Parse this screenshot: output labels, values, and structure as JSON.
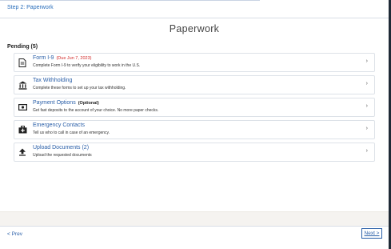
{
  "header": {
    "step_label": "Step 2: Paperwork"
  },
  "page": {
    "title": "Paperwork"
  },
  "section": {
    "heading": "Pending (5)"
  },
  "tasks": [
    {
      "title": "Form I-9",
      "due": "(Due Jun 7, 2023)",
      "description": "Complete Form I-9 to verify your eligibility to work in the U.S.",
      "icon": "document-icon"
    },
    {
      "title": "Tax Withholding",
      "description": "Complete these forms to set up your tax withholding.",
      "icon": "bank-icon"
    },
    {
      "title": "Payment Options",
      "extra": "(Optional)",
      "description": "Get fast deposits to the account of your choice. No more paper checks.",
      "icon": "money-icon"
    },
    {
      "title": "Emergency Contacts",
      "description": "Tell us who to call in case of an emergency.",
      "icon": "first-aid-icon"
    },
    {
      "title": "Upload Documents (2)",
      "description": "Upload the requested documents",
      "icon": "upload-icon"
    }
  ],
  "footer": {
    "prev_label": "< Prev",
    "next_label": "Next >"
  },
  "colors": {
    "link": "#2a5fa8",
    "due": "#d22b2b"
  }
}
